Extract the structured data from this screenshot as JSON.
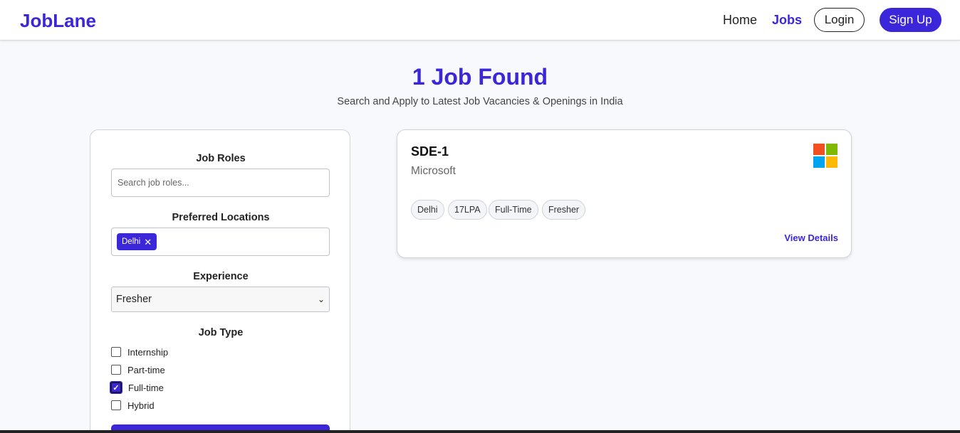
{
  "nav": {
    "logo": "JobLane",
    "home": "Home",
    "jobs": "Jobs",
    "login": "Login",
    "signup": "Sign Up"
  },
  "header": {
    "title": "1 Job Found",
    "subtitle": "Search and Apply to Latest Job Vacancies & Openings in India"
  },
  "filters": {
    "job_roles_label": "Job Roles",
    "job_roles_placeholder": "Search job roles...",
    "locations_label": "Preferred Locations",
    "selected_locations": [
      "Delhi"
    ],
    "experience_label": "Experience",
    "experience_value": "Fresher",
    "job_type_label": "Job Type",
    "job_types": [
      {
        "label": "Internship",
        "checked": false
      },
      {
        "label": "Part-time",
        "checked": false
      },
      {
        "label": "Full-time",
        "checked": true
      },
      {
        "label": "Hybrid",
        "checked": false
      }
    ]
  },
  "job": {
    "title": "SDE-1",
    "company": "Microsoft",
    "tags": [
      "Delhi",
      "17LPA",
      "Full-Time",
      "Fresher"
    ],
    "view_details": "View Details",
    "logo_colors": [
      "#f25022",
      "#7fba00",
      "#00a4ef",
      "#ffb900"
    ]
  },
  "colors": {
    "accent": "#3b27d9"
  },
  "icons": {
    "remove_chip": "close-icon",
    "select_arrow": "chevron-down-icon",
    "checkmark": "check-icon",
    "company_logo": "microsoft-logo"
  }
}
